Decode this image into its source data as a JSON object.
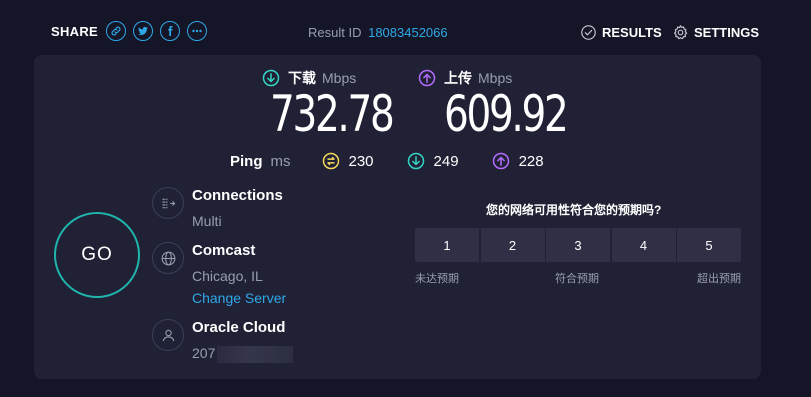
{
  "share": {
    "label": "SHARE",
    "icons": [
      "link-icon",
      "twitter-icon",
      "facebook-icon",
      "more-icon"
    ]
  },
  "result": {
    "label": "Result ID",
    "id": "18083452066"
  },
  "nav": {
    "results": "RESULTS",
    "settings": "SETTINGS"
  },
  "download": {
    "label": "下载",
    "unit": "Mbps",
    "value": "732.78"
  },
  "upload": {
    "label": "上传",
    "unit": "Mbps",
    "value": "609.92"
  },
  "ping": {
    "label": "Ping",
    "unit": "ms",
    "idle": "230",
    "down": "249",
    "up": "228"
  },
  "go": {
    "label": "GO"
  },
  "connections": {
    "title": "Connections",
    "value": "Multi"
  },
  "isp": {
    "title": "Comcast",
    "location": "Chicago, IL",
    "change": "Change Server"
  },
  "server": {
    "title": "Oracle Cloud",
    "ip_prefix": "207"
  },
  "survey": {
    "question": "您的网络可用性符合您的预期吗?",
    "options": [
      "1",
      "2",
      "3",
      "4",
      "5"
    ],
    "low": "未达预期",
    "mid": "符合预期",
    "high": "超出预期"
  },
  "colors": {
    "background": "#141526",
    "card": "#202135",
    "accent_blue": "#2fa8e8",
    "download_teal": "#35d6c6",
    "upload_purple": "#b46cff",
    "ping_yellow": "#f5d95a",
    "go_ring": "#1fb5ae"
  }
}
